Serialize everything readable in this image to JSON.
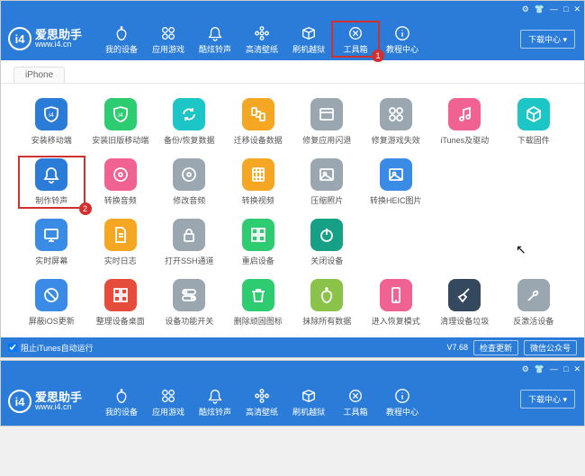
{
  "brand": {
    "name": "爱思助手",
    "url": "www.i4.cn",
    "logo_letter": "i4"
  },
  "titlebar": {
    "settings": "⚙",
    "skin": "👕",
    "min": "—",
    "max": "□",
    "close": "✕"
  },
  "nav": [
    {
      "id": "device",
      "label": "我的设备",
      "icon": "apple"
    },
    {
      "id": "apps",
      "label": "应用游戏",
      "icon": "apps"
    },
    {
      "id": "ringtone",
      "label": "酷炫铃声",
      "icon": "bell"
    },
    {
      "id": "wallpaper",
      "label": "高清壁纸",
      "icon": "flower"
    },
    {
      "id": "jailbreak",
      "label": "刷机越狱",
      "icon": "box"
    },
    {
      "id": "tools",
      "label": "工具箱",
      "icon": "tools",
      "highlight": true,
      "badge": "1"
    },
    {
      "id": "tutorial",
      "label": "教程中心",
      "icon": "info"
    }
  ],
  "download_btn": "下载中心 ▾",
  "tab": "iPhone",
  "colors": {
    "blue": "#2b7cd9",
    "blue2": "#3a8be6",
    "orange": "#f5a623",
    "red": "#e64c3c",
    "green": "#2ecc71",
    "cyan": "#1dc6c6",
    "pink": "#f06292",
    "gray": "#9aa7b0",
    "purple": "#7c6fd6",
    "lime": "#8bc34a",
    "dkcyan": "#16a085",
    "dkblue": "#34495e"
  },
  "tools": [
    [
      {
        "label": "安装移动端",
        "icon": "shield-i4",
        "c": "blue"
      },
      {
        "label": "安装旧版移动端",
        "icon": "shield-i4",
        "c": "green"
      },
      {
        "label": "备份/恢复数据",
        "icon": "refresh",
        "c": "cyan"
      },
      {
        "label": "迁移设备数据",
        "icon": "transfer",
        "c": "orange"
      },
      {
        "label": "修复应用闪退",
        "icon": "window",
        "c": "gray"
      },
      {
        "label": "修复游戏失效",
        "icon": "apps",
        "c": "gray"
      },
      {
        "label": "iTunes及驱动",
        "icon": "note",
        "c": "pink"
      },
      {
        "label": "下载固件",
        "icon": "cube",
        "c": "cyan"
      }
    ],
    [
      {
        "label": "制作铃声",
        "icon": "bell",
        "c": "blue",
        "highlight": true,
        "badge": "2"
      },
      {
        "label": "转换音频",
        "icon": "disc",
        "c": "pink"
      },
      {
        "label": "修改音频",
        "icon": "disc",
        "c": "gray"
      },
      {
        "label": "转换视频",
        "icon": "film",
        "c": "orange"
      },
      {
        "label": "压缩照片",
        "icon": "image",
        "c": "gray"
      },
      {
        "label": "转换HEIC图片",
        "icon": "image",
        "c": "blue2"
      }
    ],
    [
      {
        "label": "实时屏幕",
        "icon": "monitor",
        "c": "blue2"
      },
      {
        "label": "实时日志",
        "icon": "doc",
        "c": "orange"
      },
      {
        "label": "打开SSH通道",
        "icon": "lock",
        "c": "gray"
      },
      {
        "label": "重启设备",
        "icon": "grid4",
        "c": "green"
      },
      {
        "label": "关闭设备",
        "icon": "power",
        "c": "dkcyan"
      }
    ],
    [
      {
        "label": "屏蔽iOS更新",
        "icon": "noupdate",
        "c": "blue2"
      },
      {
        "label": "整理设备桌面",
        "icon": "grid4",
        "c": "red"
      },
      {
        "label": "设备功能开关",
        "icon": "toggles",
        "c": "gray"
      },
      {
        "label": "删除顽固图标",
        "icon": "trash",
        "c": "green"
      },
      {
        "label": "抹除所有数据",
        "icon": "apple",
        "c": "lime"
      },
      {
        "label": "进入恢复模式",
        "icon": "phone",
        "c": "pink"
      },
      {
        "label": "清理设备垃圾",
        "icon": "broom",
        "c": "dkblue"
      },
      {
        "label": "反激活设备",
        "icon": "wrench",
        "c": "gray"
      }
    ]
  ],
  "footer": {
    "checkbox": "阻止iTunes自动运行",
    "version": "V7.68",
    "check_update": "检查更新",
    "wechat": "微信公众号"
  }
}
